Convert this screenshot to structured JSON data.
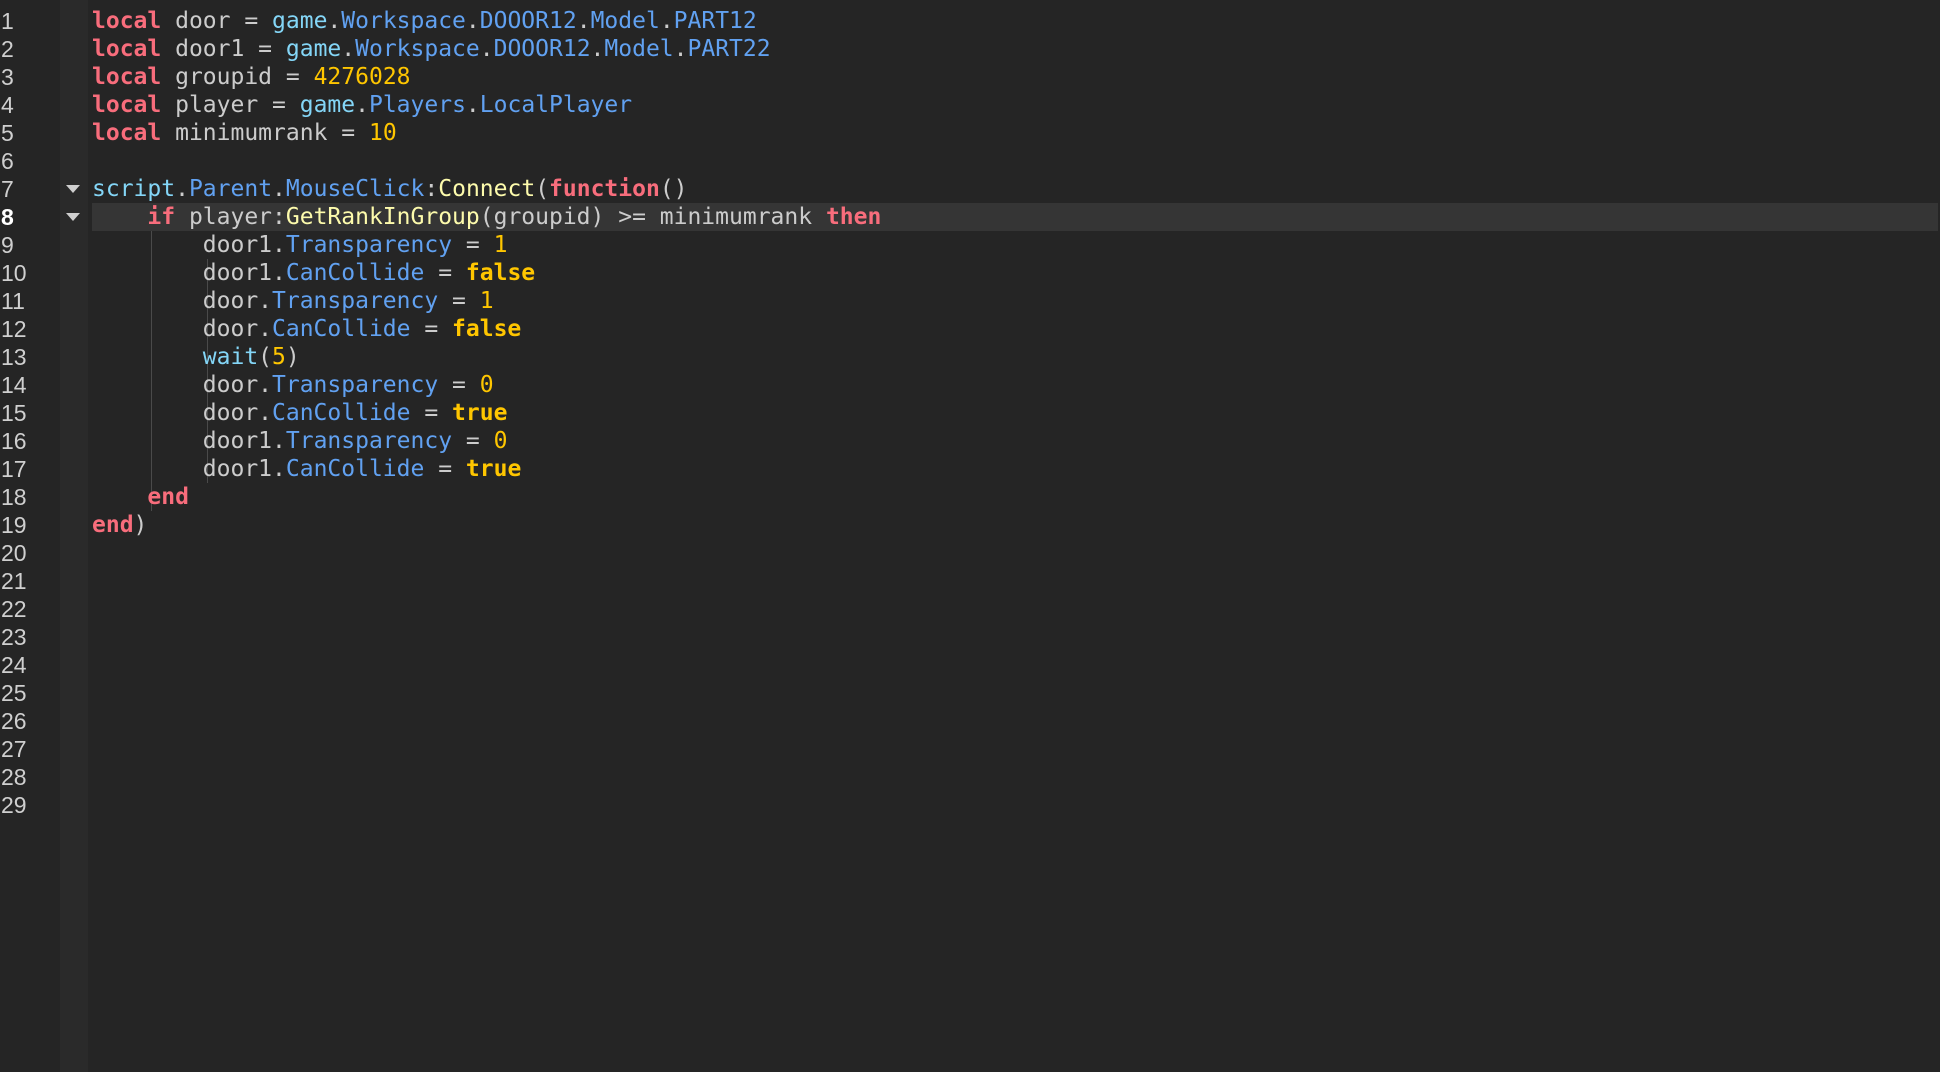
{
  "editor": {
    "current_line": 8,
    "line_count": 29,
    "folded_lines": [
      7,
      8
    ],
    "lines": [
      {
        "tokens": [
          [
            "kw",
            "local"
          ],
          [
            "txt",
            " door = "
          ],
          [
            "glob",
            "game"
          ],
          [
            "txt",
            "."
          ],
          [
            "prop",
            "Workspace"
          ],
          [
            "txt",
            "."
          ],
          [
            "prop",
            "DOOOR12"
          ],
          [
            "txt",
            "."
          ],
          [
            "prop",
            "Model"
          ],
          [
            "txt",
            "."
          ],
          [
            "prop",
            "PART12"
          ]
        ]
      },
      {
        "tokens": [
          [
            "kw",
            "local"
          ],
          [
            "txt",
            " door1 = "
          ],
          [
            "glob",
            "game"
          ],
          [
            "txt",
            "."
          ],
          [
            "prop",
            "Workspace"
          ],
          [
            "txt",
            "."
          ],
          [
            "prop",
            "DOOOR12"
          ],
          [
            "txt",
            "."
          ],
          [
            "prop",
            "Model"
          ],
          [
            "txt",
            "."
          ],
          [
            "prop",
            "PART22"
          ]
        ]
      },
      {
        "tokens": [
          [
            "kw",
            "local"
          ],
          [
            "txt",
            " groupid = "
          ],
          [
            "num",
            "4276028"
          ]
        ]
      },
      {
        "tokens": [
          [
            "kw",
            "local"
          ],
          [
            "txt",
            " player = "
          ],
          [
            "glob",
            "game"
          ],
          [
            "txt",
            "."
          ],
          [
            "prop",
            "Players"
          ],
          [
            "txt",
            "."
          ],
          [
            "prop",
            "LocalPlayer"
          ]
        ]
      },
      {
        "tokens": [
          [
            "kw",
            "local"
          ],
          [
            "txt",
            " minimumrank = "
          ],
          [
            "num",
            "10"
          ]
        ]
      },
      {
        "tokens": []
      },
      {
        "tokens": [
          [
            "glob",
            "script"
          ],
          [
            "txt",
            "."
          ],
          [
            "prop",
            "Parent"
          ],
          [
            "txt",
            "."
          ],
          [
            "prop",
            "MouseClick"
          ],
          [
            "txt",
            ":"
          ],
          [
            "fn",
            "Connect"
          ],
          [
            "txt",
            "("
          ],
          [
            "kw",
            "function"
          ],
          [
            "txt",
            "()"
          ]
        ]
      },
      {
        "tokens": [
          [
            "txt",
            "    "
          ],
          [
            "kw",
            "if"
          ],
          [
            "txt",
            " player:"
          ],
          [
            "fn",
            "GetRankInGroup"
          ],
          [
            "txt",
            "(groupid) >= minimumrank "
          ],
          [
            "kw",
            "then"
          ]
        ]
      },
      {
        "tokens": [
          [
            "txt",
            "        door1."
          ],
          [
            "prop",
            "Transparency"
          ],
          [
            "txt",
            " = "
          ],
          [
            "num",
            "1"
          ]
        ]
      },
      {
        "tokens": [
          [
            "txt",
            "        door1."
          ],
          [
            "prop",
            "CanCollide"
          ],
          [
            "txt",
            " = "
          ],
          [
            "bool",
            "false"
          ]
        ]
      },
      {
        "tokens": [
          [
            "txt",
            "        door."
          ],
          [
            "prop",
            "Transparency"
          ],
          [
            "txt",
            " = "
          ],
          [
            "num",
            "1"
          ]
        ]
      },
      {
        "tokens": [
          [
            "txt",
            "        door."
          ],
          [
            "prop",
            "CanCollide"
          ],
          [
            "txt",
            " = "
          ],
          [
            "bool",
            "false"
          ]
        ]
      },
      {
        "tokens": [
          [
            "txt",
            "        "
          ],
          [
            "glob",
            "wait"
          ],
          [
            "txt",
            "("
          ],
          [
            "num",
            "5"
          ],
          [
            "txt",
            ")"
          ]
        ]
      },
      {
        "tokens": [
          [
            "txt",
            "        door."
          ],
          [
            "prop",
            "Transparency"
          ],
          [
            "txt",
            " = "
          ],
          [
            "num",
            "0"
          ]
        ]
      },
      {
        "tokens": [
          [
            "txt",
            "        door."
          ],
          [
            "prop",
            "CanCollide"
          ],
          [
            "txt",
            " = "
          ],
          [
            "bool",
            "true"
          ]
        ]
      },
      {
        "tokens": [
          [
            "txt",
            "        door1."
          ],
          [
            "prop",
            "Transparency"
          ],
          [
            "txt",
            " = "
          ],
          [
            "num",
            "0"
          ]
        ]
      },
      {
        "tokens": [
          [
            "txt",
            "        door1."
          ],
          [
            "prop",
            "CanCollide"
          ],
          [
            "txt",
            " = "
          ],
          [
            "bool",
            "true"
          ]
        ]
      },
      {
        "tokens": [
          [
            "txt",
            "    "
          ],
          [
            "kw",
            "end"
          ]
        ]
      },
      {
        "tokens": [
          [
            "kw",
            "end"
          ],
          [
            "txt",
            ")"
          ]
        ]
      },
      {
        "tokens": []
      },
      {
        "tokens": []
      },
      {
        "tokens": []
      },
      {
        "tokens": []
      },
      {
        "tokens": []
      },
      {
        "tokens": []
      },
      {
        "tokens": []
      },
      {
        "tokens": []
      },
      {
        "tokens": []
      },
      {
        "tokens": []
      }
    ]
  },
  "colors": {
    "background": "#252525",
    "gutter": "#2a2a2a",
    "current_line": "#353535",
    "keyword": "#f86d7c",
    "boolean_number": "#ffc600",
    "global": "#84d6f7",
    "property": "#61a1f1",
    "function": "#fdfbac",
    "text": "#cccccc"
  },
  "icons": {
    "fold": "chevron-down-icon"
  }
}
